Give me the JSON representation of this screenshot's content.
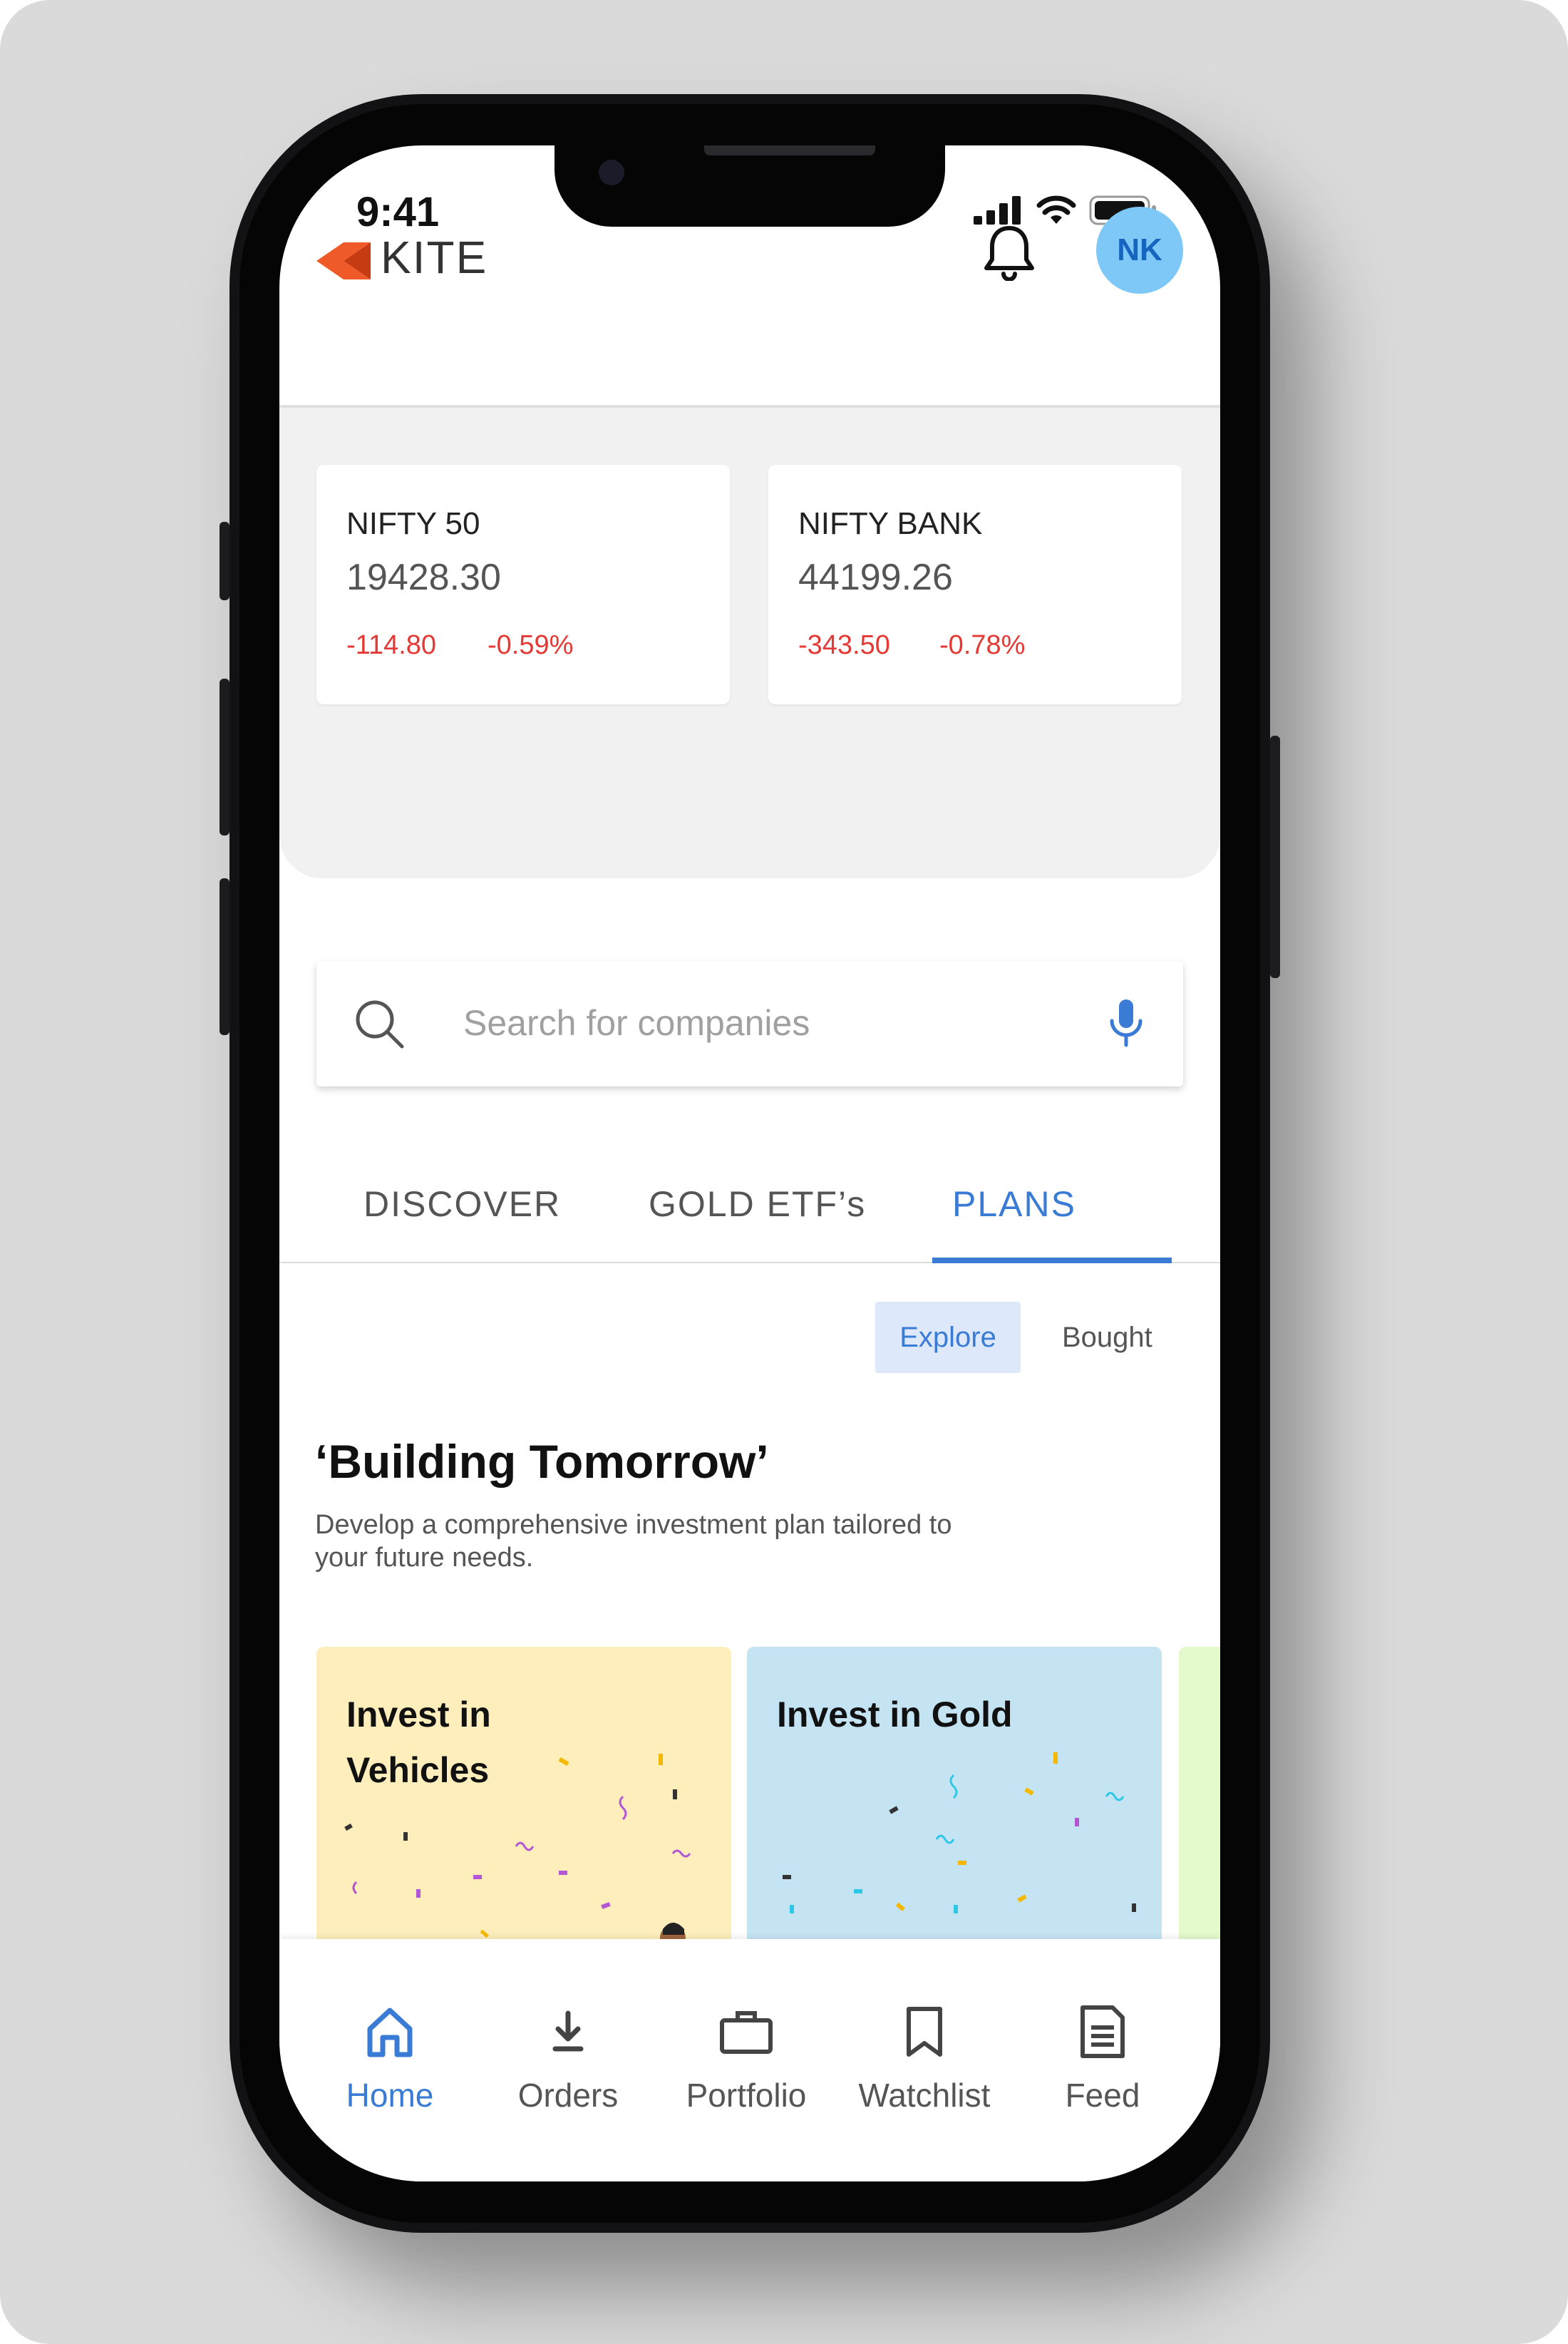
{
  "status_bar": {
    "time": "9:41"
  },
  "header": {
    "logo_text": "KITE",
    "avatar_initials": "NK"
  },
  "indices": [
    {
      "name": "NIFTY 50",
      "value": "19428.30",
      "change": "-114.80",
      "change_pct": "-0.59%"
    },
    {
      "name": "NIFTY BANK",
      "value": "44199.26",
      "change": "-343.50",
      "change_pct": "-0.78%"
    }
  ],
  "search": {
    "placeholder": "Search for companies"
  },
  "tabs": [
    {
      "label": "DISCOVER",
      "active": false
    },
    {
      "label": "GOLD ETF’s",
      "active": false
    },
    {
      "label": "PLANS",
      "active": true
    }
  ],
  "segment": {
    "explore": "Explore",
    "bought": "Bought",
    "selected": "Explore"
  },
  "section": {
    "title": "‘Building Tomorrow’",
    "subtitle": "Develop a comprehensive investment plan tailored to your future needs."
  },
  "plans": [
    {
      "title": "Invest in Vehicles",
      "bg": "#fdeebb"
    },
    {
      "title": "Invest in Gold",
      "bg": "#c4e4f4"
    },
    {
      "title": "",
      "bg": "#e4f9cc"
    }
  ],
  "bottom_nav": [
    {
      "label": "Home",
      "icon": "home-icon",
      "active": true
    },
    {
      "label": "Orders",
      "icon": "download-icon",
      "active": false
    },
    {
      "label": "Portfolio",
      "icon": "briefcase-icon",
      "active": false
    },
    {
      "label": "Watchlist",
      "icon": "bookmark-icon",
      "active": false
    },
    {
      "label": "Feed",
      "icon": "document-icon",
      "active": false
    }
  ],
  "colors": {
    "accent": "#3a7bd5",
    "negative": "#e53935",
    "brand": "#f05a28"
  }
}
